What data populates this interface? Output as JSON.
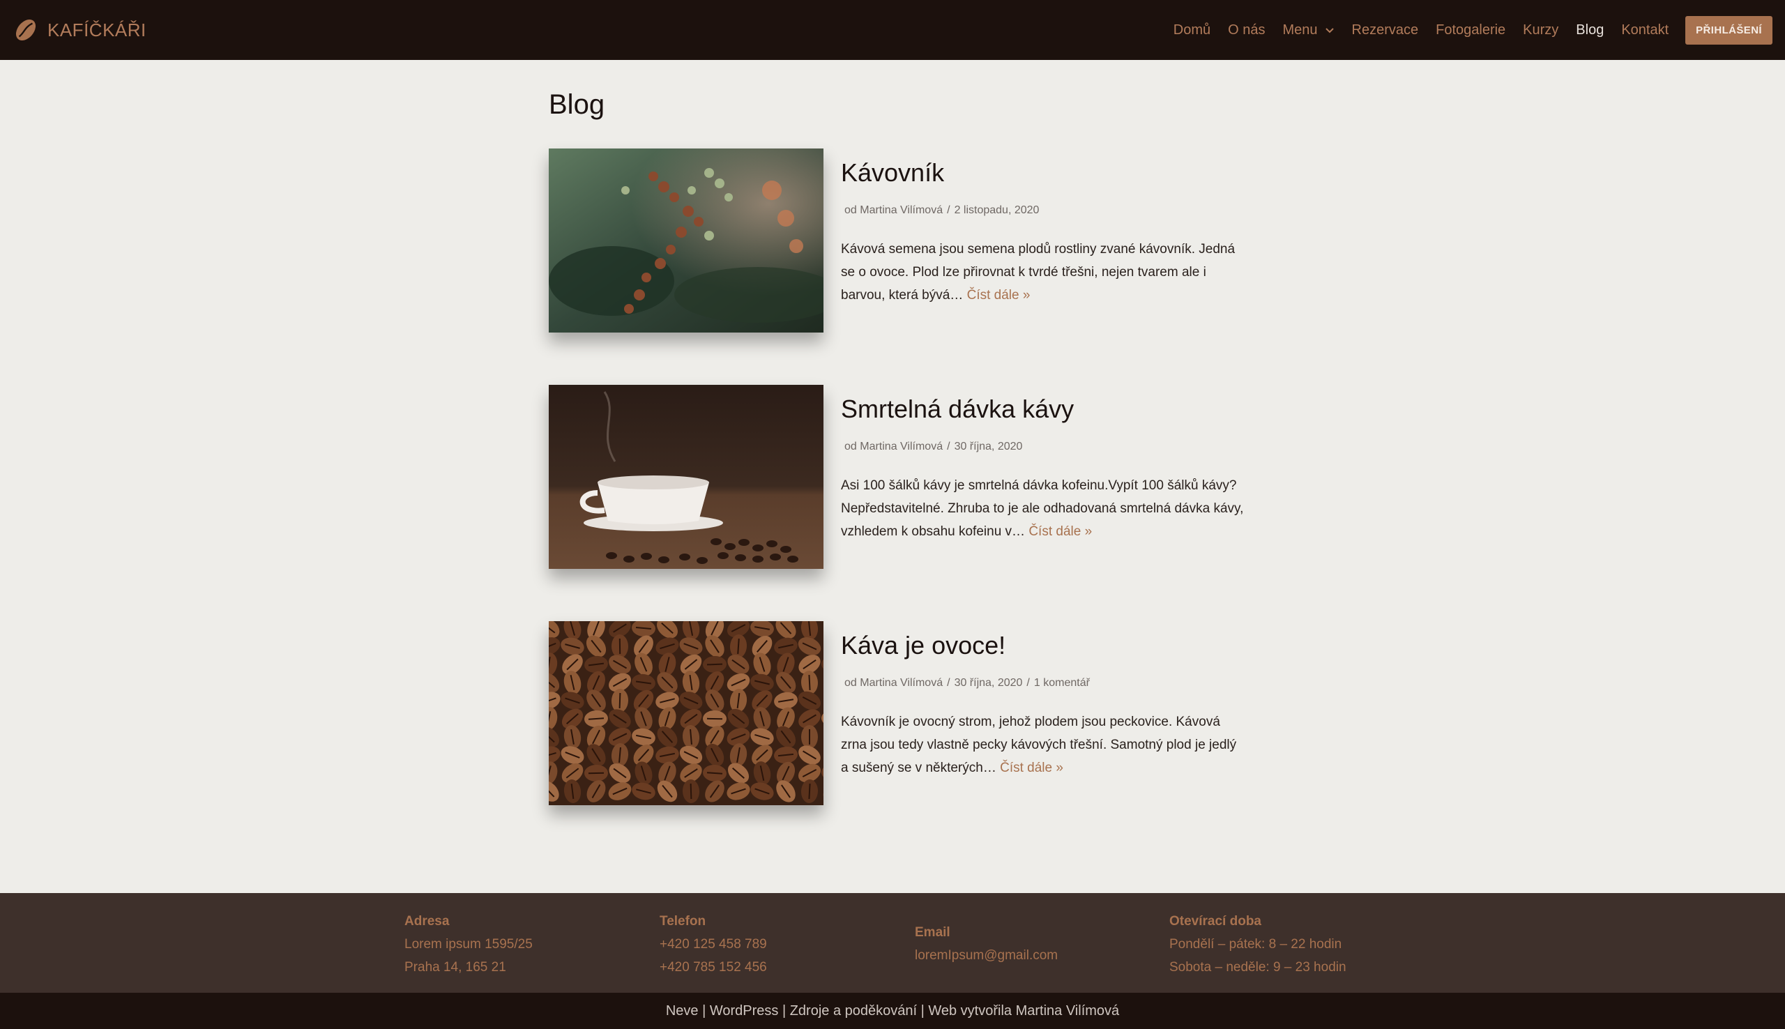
{
  "header": {
    "brand": "KAFÍČKÁŘI",
    "nav": [
      {
        "label": "Domů"
      },
      {
        "label": "O nás"
      },
      {
        "label": "Menu"
      },
      {
        "label": "Rezervace"
      },
      {
        "label": "Fotogalerie"
      },
      {
        "label": "Kurzy"
      },
      {
        "label": "Blog"
      },
      {
        "label": "Kontakt"
      }
    ],
    "login": "PŘIHLÁŠENÍ"
  },
  "main": {
    "title": "Blog",
    "posts": [
      {
        "title": "Kávovník",
        "author": "od Martina Vilímová",
        "date": "2 listopadu, 2020",
        "excerpt": "Kávová semena jsou semena plodů rostliny zvané kávovník. Jedná se o ovoce. Plod lze přirovnat k tvrdé třešni, nejen tvarem ale i barvou, která bývá…",
        "read_more": "Číst dále »"
      },
      {
        "title": "Smrtelná dávka kávy",
        "author": "od Martina Vilímová",
        "date": "30 října, 2020",
        "excerpt": "Asi 100 šálků kávy je smrtelná dávka kofeinu.Vypít 100 šálků kávy? Nepředstavitelné. Zhruba to je ale odhadovaná smrtelná dávka kávy, vzhledem k obsahu kofeinu v…",
        "read_more": "Číst dále »"
      },
      {
        "title": "Káva je ovoce!",
        "author": "od Martina Vilímová",
        "date": "30 října, 2020",
        "comments": "1 komentář",
        "excerpt": "Kávovník je ovocný strom, jehož plodem jsou peckovice. Kávová zrna jsou tedy vlastně pecky kávových třešní. Samotný plod je jedlý a sušený se v některých…",
        "read_more": "Číst dále »"
      }
    ]
  },
  "footer": {
    "address": {
      "title": "Adresa",
      "line1": "Lorem ipsum 1595/25",
      "line2": "Praha 14, 165 21"
    },
    "phone": {
      "title": "Telefon",
      "line1": "+420 125 458 789",
      "line2": "+420 785 152 456"
    },
    "email": {
      "title": "Email",
      "line1": "loremIpsum@gmail.com"
    },
    "hours": {
      "title": "Otevírací doba",
      "line1": "Pondělí – pátek: 8 – 22 hodin",
      "line2": "Sobota – neděle: 9 – 23 hodin"
    },
    "bottom": {
      "neve": "Neve",
      "sep": " | ",
      "wordpress": "WordPress",
      "credits": "Zdroje a poděkování",
      "author": "Web vytvořila Martina Vilímová"
    }
  },
  "colors": {
    "header_bg": "#1c110d",
    "accent": "#a8724f",
    "page_bg": "#eeede9",
    "footer_bg": "#3e302b"
  },
  "icons": [
    "coffee-bean-icon",
    "chevron-down-icon"
  ]
}
